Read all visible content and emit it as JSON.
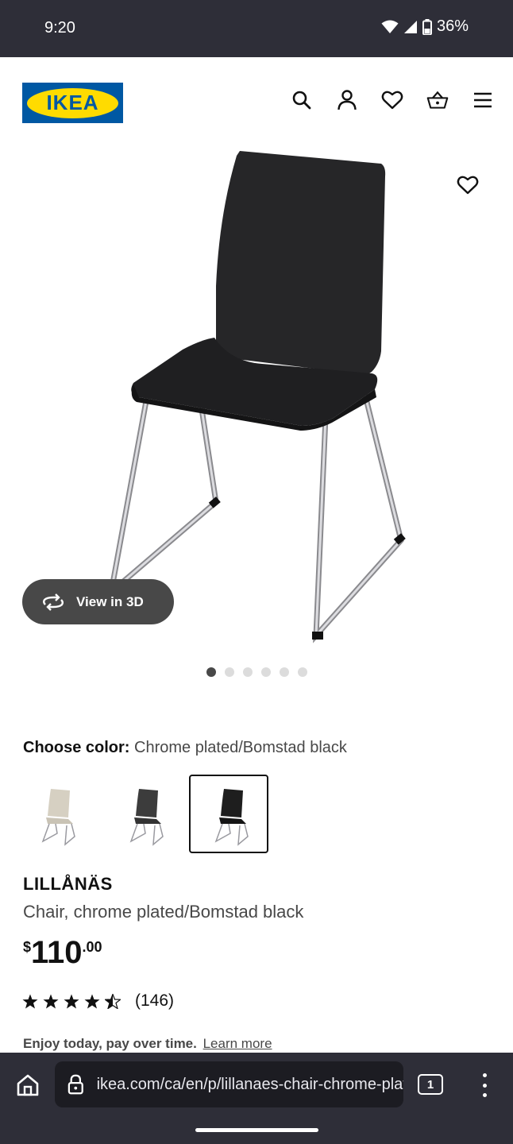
{
  "status_bar": {
    "time": "9:20",
    "battery": "36%"
  },
  "header": {
    "logo_text": "IKEA"
  },
  "gallery": {
    "view3d_label": "View in 3D",
    "image_count": 6,
    "active_index": 0
  },
  "color_chooser": {
    "label": "Choose color:",
    "selected_value": "Chrome plated/Bomstad black",
    "swatches": [
      {
        "color": "#d6d0c2",
        "selected": false
      },
      {
        "color": "#3c3c3c",
        "selected": false
      },
      {
        "color": "#1e1e1e",
        "selected": true
      }
    ]
  },
  "product": {
    "name": "LILLÅNÄS",
    "description": "Chair, chrome plated/Bomstad black",
    "price": {
      "currency": "$",
      "integer": "110",
      "decimal": ".00"
    },
    "rating": {
      "stars": 4.5,
      "count": "(146)"
    },
    "pay": {
      "bold": "Enjoy today, pay over time.",
      "link": "Learn more"
    }
  },
  "browser": {
    "url": "ikea.com/ca/en/p/lillanaes-chair-chrome-plated",
    "tab_count": "1"
  },
  "colors": {
    "brand_blue": "#0058a3",
    "brand_yellow": "#ffdb00",
    "system_bar": "#2e2e38"
  }
}
